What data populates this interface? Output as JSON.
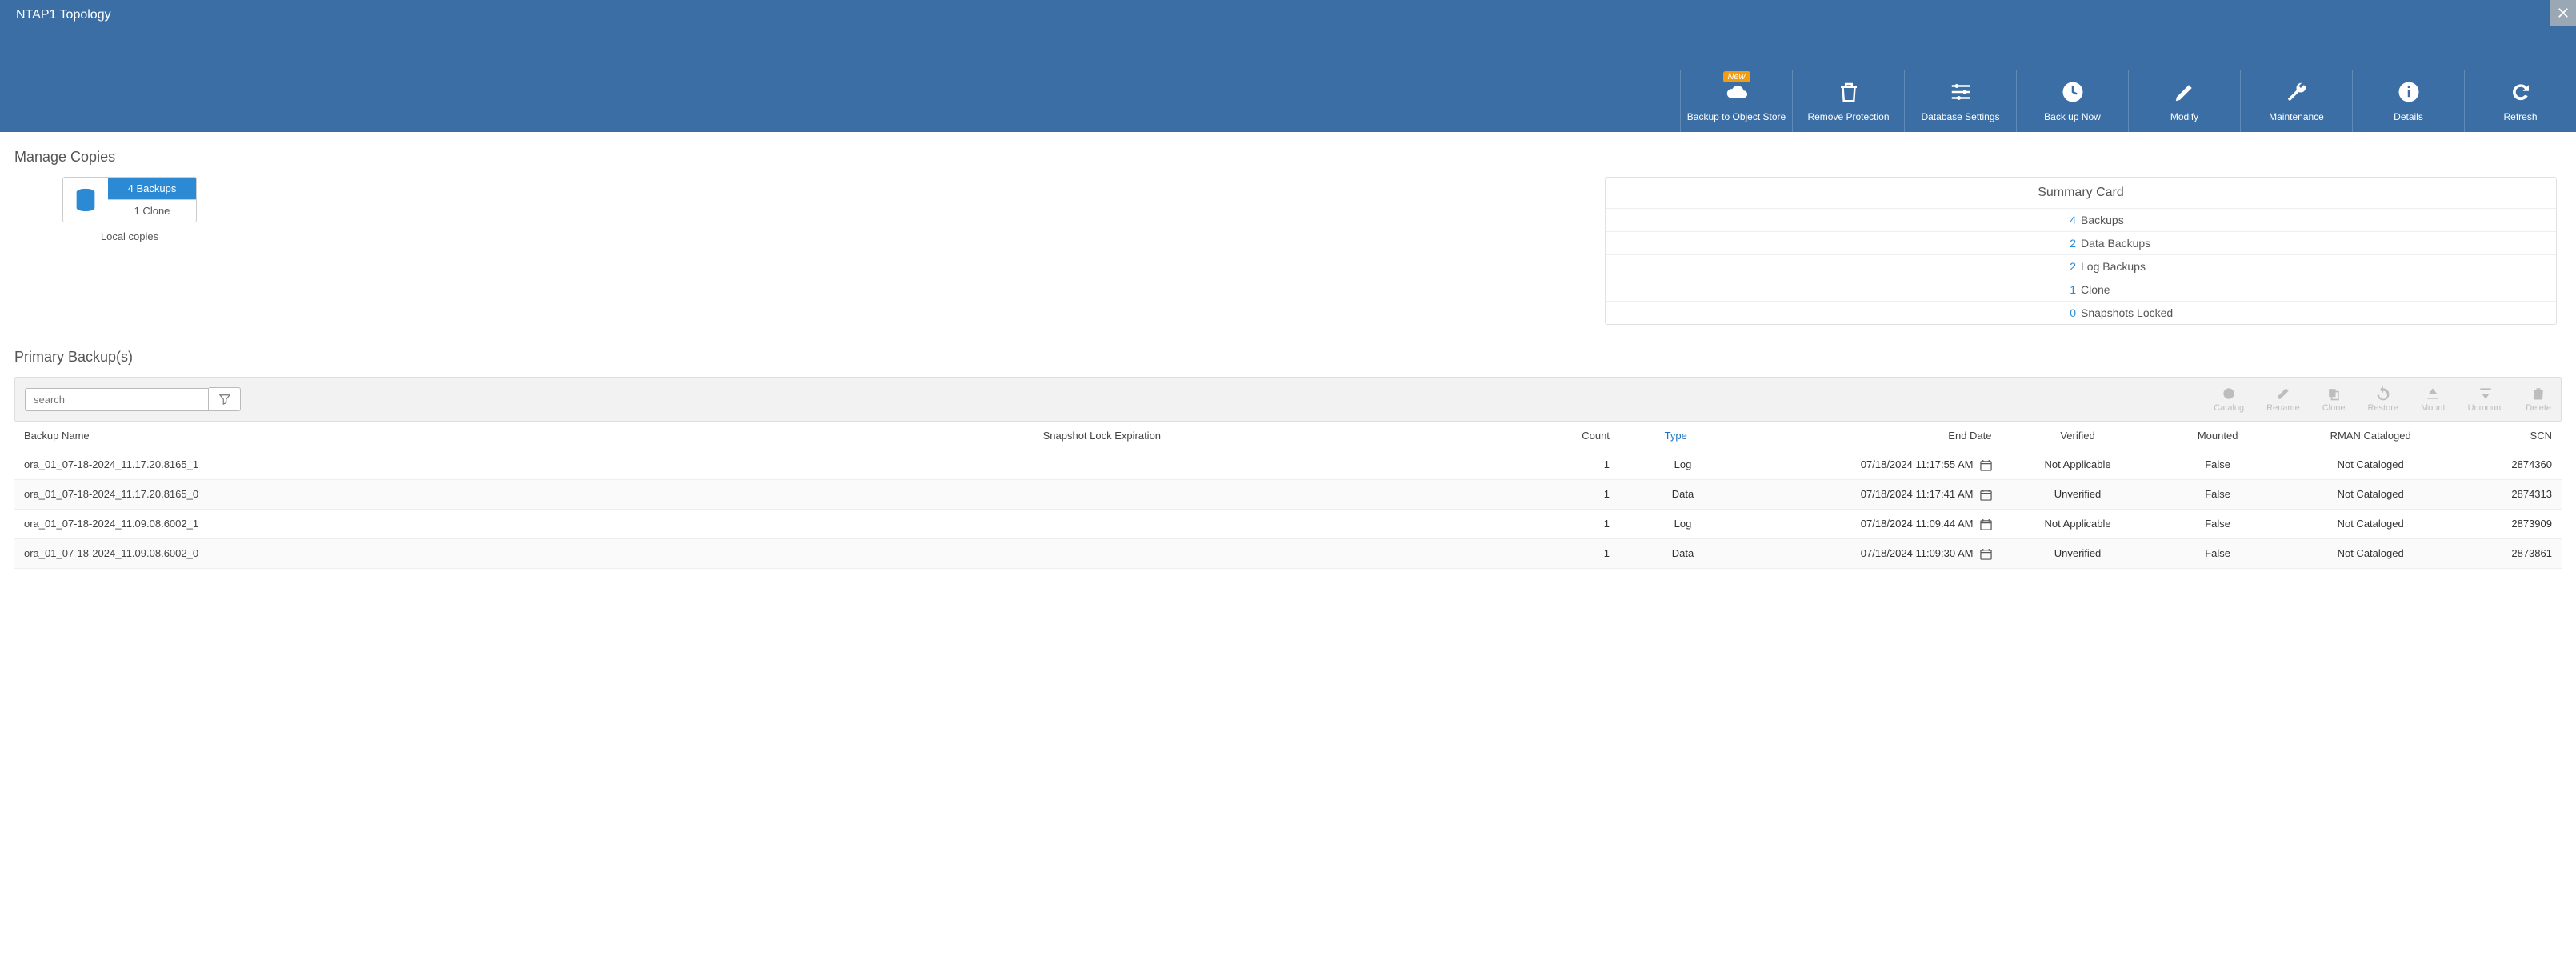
{
  "header": {
    "title": "NTAP1 Topology"
  },
  "toolbar": {
    "backup_object": {
      "label": "Backup to Object Store",
      "badge": "New"
    },
    "remove_protection": "Remove Protection",
    "database_settings": "Database Settings",
    "back_up_now": "Back up Now",
    "modify": "Modify",
    "maintenance": "Maintenance",
    "details": "Details",
    "refresh": "Refresh"
  },
  "sections": {
    "manage_copies": "Manage Copies",
    "primary_backups": "Primary Backup(s)"
  },
  "copies_card": {
    "backups": "4 Backups",
    "clone": "1 Clone",
    "sublabel": "Local copies"
  },
  "summary": {
    "title": "Summary Card",
    "rows": [
      {
        "num": "4",
        "label": "Backups"
      },
      {
        "num": "2",
        "label": "Data Backups"
      },
      {
        "num": "2",
        "label": "Log Backups"
      },
      {
        "num": "1",
        "label": "Clone"
      },
      {
        "num": "0",
        "label": "Snapshots Locked"
      }
    ]
  },
  "search": {
    "placeholder": "search"
  },
  "row_actions": {
    "catalog": "Catalog",
    "rename": "Rename",
    "clone": "Clone",
    "restore": "Restore",
    "mount": "Mount",
    "unmount": "Unmount",
    "delete": "Delete"
  },
  "table": {
    "headers": {
      "backup_name": "Backup Name",
      "snapshot_lock": "Snapshot Lock Expiration",
      "count": "Count",
      "type": "Type",
      "end_date": "End Date",
      "verified": "Verified",
      "mounted": "Mounted",
      "rman": "RMAN Cataloged",
      "scn": "SCN"
    },
    "rows": [
      {
        "name": "ora_01_07-18-2024_11.17.20.8165_1",
        "lock": "",
        "count": "1",
        "type": "Log",
        "end": "07/18/2024 11:17:55 AM",
        "verified": "Not Applicable",
        "mounted": "False",
        "rman": "Not Cataloged",
        "scn": "2874360"
      },
      {
        "name": "ora_01_07-18-2024_11.17.20.8165_0",
        "lock": "",
        "count": "1",
        "type": "Data",
        "end": "07/18/2024 11:17:41 AM",
        "verified": "Unverified",
        "mounted": "False",
        "rman": "Not Cataloged",
        "scn": "2874313"
      },
      {
        "name": "ora_01_07-18-2024_11.09.08.6002_1",
        "lock": "",
        "count": "1",
        "type": "Log",
        "end": "07/18/2024 11:09:44 AM",
        "verified": "Not Applicable",
        "mounted": "False",
        "rman": "Not Cataloged",
        "scn": "2873909"
      },
      {
        "name": "ora_01_07-18-2024_11.09.08.6002_0",
        "lock": "",
        "count": "1",
        "type": "Data",
        "end": "07/18/2024 11:09:30 AM",
        "verified": "Unverified",
        "mounted": "False",
        "rman": "Not Cataloged",
        "scn": "2873861"
      }
    ]
  }
}
